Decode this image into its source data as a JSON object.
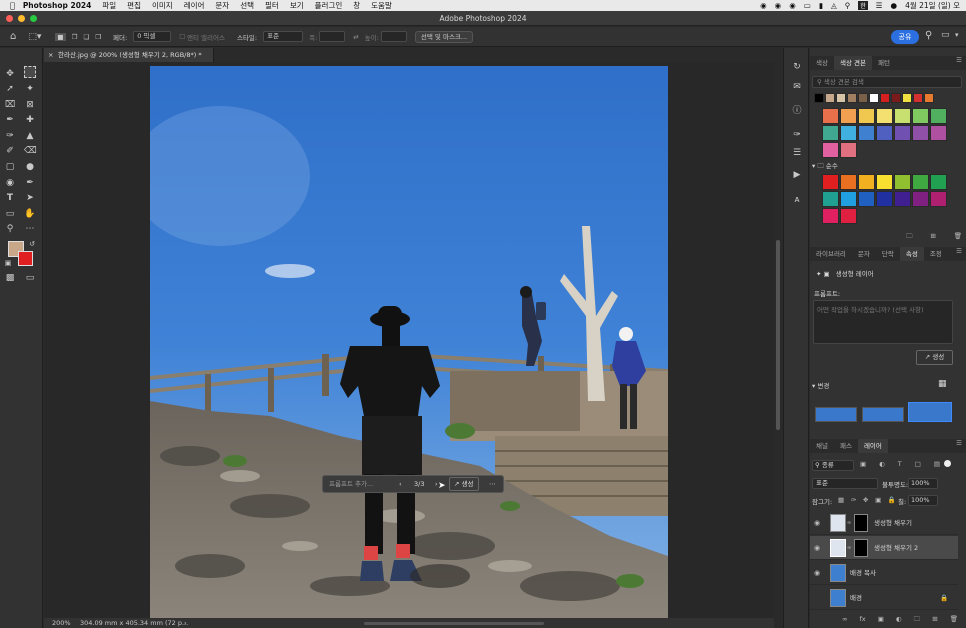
{
  "menubar": {
    "app_name": "Photoshop 2024",
    "items": [
      "파일",
      "편집",
      "이미지",
      "레이어",
      "문자",
      "선택",
      "필터",
      "보기",
      "플러그인",
      "창",
      "도움말"
    ],
    "clock": "4월 21일 (일) 오"
  },
  "window": {
    "title": "Adobe Photoshop 2024"
  },
  "options_bar": {
    "feather_label": "페더:",
    "feather_value": "0 픽셀",
    "antialias_label": "앤티 앨리어스",
    "style_label": "스타일:",
    "style_value": "표준",
    "width_label": "폭:",
    "height_label": "높이:",
    "select_mask_label": "선택 및 마스크...",
    "share_label": "공유"
  },
  "document": {
    "tab_title": "한라산.jpg @ 200% (생성형 채우기 2, RGB/8*) *",
    "zoom": "200%",
    "doc_info": "304.09 mm x 405.34 mm (72 p..."
  },
  "context_bar": {
    "prompt_placeholder": "프롬프트 추가...",
    "counter": "3/3",
    "generate_label": "생성"
  },
  "colors_panel": {
    "tabs": [
      "색상",
      "색상 견본",
      "패턴"
    ],
    "active_tab": "색상 견본",
    "search_placeholder": "색상 견본 검색",
    "group_name": "순수",
    "recent_swatches": [
      "#000000",
      "#c8a88a",
      "#d6c4a8",
      "#a08060",
      "#7a6048",
      "#ffffff",
      "#d42020",
      "#7a1a1a",
      "#f0e040",
      "#d43030",
      "#e87a30"
    ],
    "group1_swatches": [
      [
        "#e8704a",
        "#f0a050",
        "#f0c850",
        "#f4e070",
        "#c8e070",
        "#80c860",
        "#50b060"
      ],
      [
        "#40a890",
        "#40b0e0",
        "#4080d0",
        "#5060c0",
        "#7050b0",
        "#9050a8",
        "#b050a0"
      ],
      [
        "#e060a0",
        "#e07080"
      ]
    ],
    "group2_swatches": [
      [
        "#e02020",
        "#e87020",
        "#f0b020",
        "#f8e030",
        "#90c030",
        "#40a840",
        "#20a050"
      ],
      [
        "#20a090",
        "#20a0e0",
        "#2060c0",
        "#2030a0",
        "#402090",
        "#802080",
        "#b02070"
      ],
      [
        "#e02060",
        "#e02040"
      ]
    ]
  },
  "properties_panel": {
    "tabs": [
      "라이브러리",
      "문자",
      "단락",
      "속성",
      "조정"
    ],
    "active_tab": "속성",
    "layer_type": "생성형 레이어",
    "prompt_label": "프롬프트:",
    "prompt_placeholder": "어떤 작업을 하시겠습니까? (선택 사항)",
    "generate_label": "생성",
    "variations_label": "변경"
  },
  "layers_panel": {
    "tabs": [
      "채널",
      "패스",
      "레이어"
    ],
    "active_tab": "레이어",
    "kind_filter": "종류",
    "blend_mode": "표준",
    "opacity_label": "불투명도:",
    "opacity_value": "100%",
    "lock_label": "잠그기:",
    "fill_label": "칠:",
    "fill_value": "100%",
    "layers": [
      {
        "name": "생성형 채우기",
        "selected": false
      },
      {
        "name": "생성형 채우기 2",
        "selected": true
      },
      {
        "name": "배경 복사",
        "selected": false
      },
      {
        "name": "배경",
        "selected": false
      }
    ]
  }
}
